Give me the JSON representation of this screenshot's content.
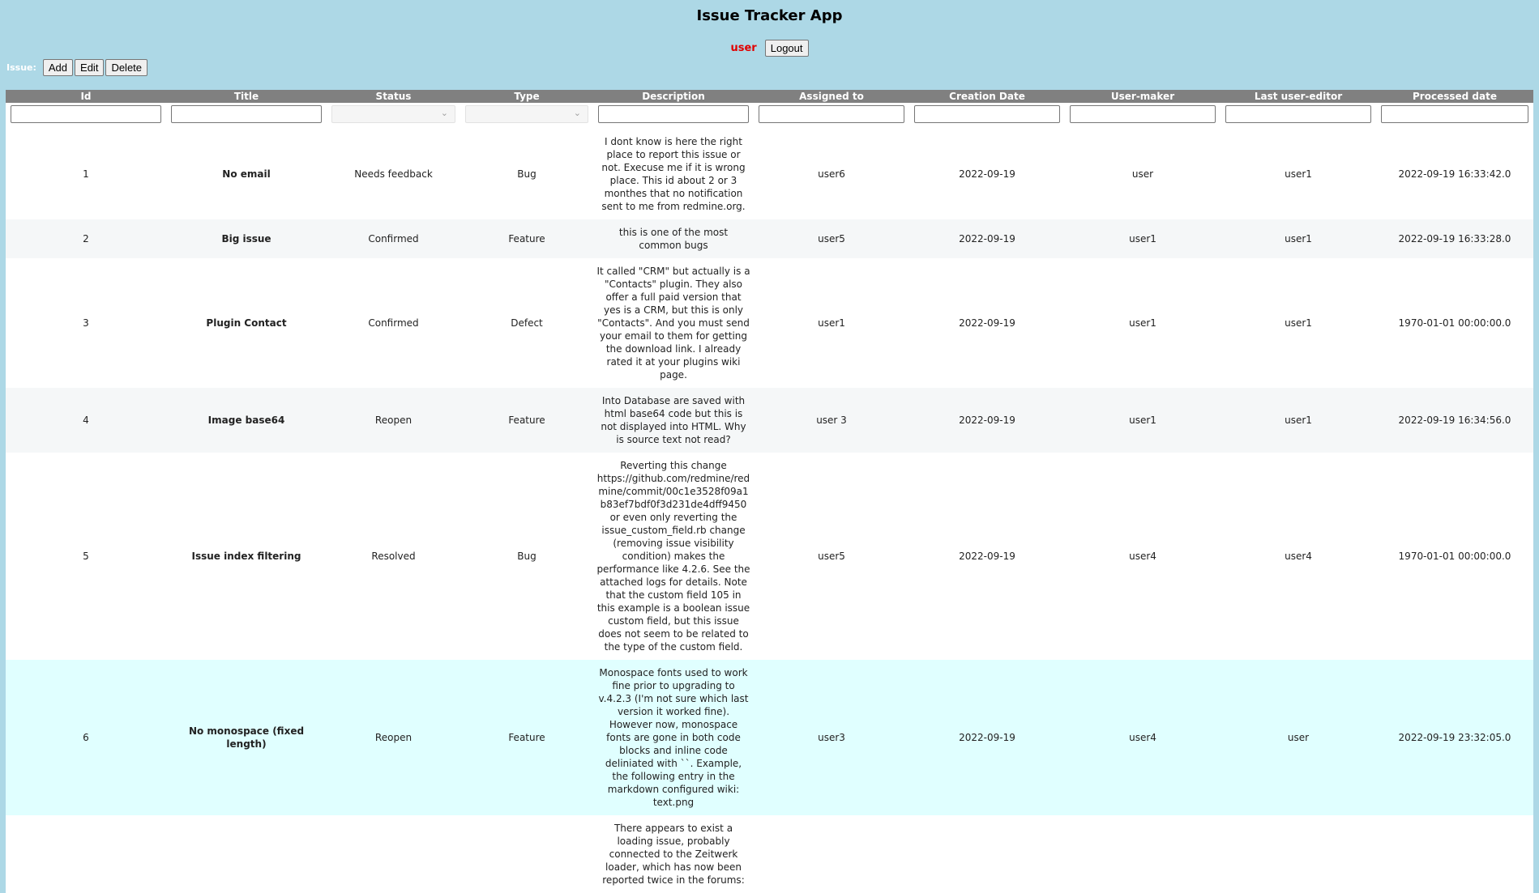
{
  "app": {
    "title": "Issue Tracker App",
    "user_name": "user",
    "logout_label": "Logout",
    "user_color": "#e00000",
    "background_color": "#add8e6"
  },
  "toolbar": {
    "label": "Issue:",
    "add_label": "Add",
    "edit_label": "Edit",
    "delete_label": "Delete"
  },
  "table": {
    "columns": [
      "Id",
      "Title",
      "Status",
      "Type",
      "Description",
      "Assigned to",
      "Creation Date",
      "User-maker",
      "Last user-editor",
      "Processed date"
    ],
    "filters": {
      "id": "",
      "title": "",
      "status": "",
      "type": "",
      "description": "",
      "assigned_to": "",
      "creation_date": "",
      "user_maker": "",
      "last_user_editor": "",
      "processed_date": ""
    },
    "rows": [
      {
        "id": "1",
        "title": "No email",
        "status": "Needs feedback",
        "type": "Bug",
        "description": "I dont know is here the right place to report this issue or not. Execuse me if it is wrong place. This id about 2 or 3 monthes that no notification sent to me from redmine.org.",
        "assigned_to": "user6",
        "creation_date": "2022-09-19",
        "user_maker": "user",
        "last_user_editor": "user1",
        "processed_date": "2022-09-19 16:33:42.0"
      },
      {
        "id": "2",
        "title": "Big issue",
        "status": "Confirmed",
        "type": "Feature",
        "description": "this is one of the most common bugs",
        "assigned_to": "user5",
        "creation_date": "2022-09-19",
        "user_maker": "user1",
        "last_user_editor": "user1",
        "processed_date": "2022-09-19 16:33:28.0"
      },
      {
        "id": "3",
        "title": "Plugin Contact",
        "status": "Confirmed",
        "type": "Defect",
        "description": "It called \"CRM\" but actually is a \"Contacts\" plugin. They also offer a full paid version that yes is a CRM, but this is only \"Contacts\". And you must send your email to them for getting the download link. I already rated it at your plugins wiki page.",
        "assigned_to": "user1",
        "creation_date": "2022-09-19",
        "user_maker": "user1",
        "last_user_editor": "user1",
        "processed_date": "1970-01-01 00:00:00.0"
      },
      {
        "id": "4",
        "title": "Image base64",
        "status": "Reopen",
        "type": "Feature",
        "description": "Into Database are saved with html base64 code but this is not displayed into HTML. Why is source text not read?",
        "assigned_to": "user 3",
        "creation_date": "2022-09-19",
        "user_maker": "user1",
        "last_user_editor": "user1",
        "processed_date": "2022-09-19 16:34:56.0"
      },
      {
        "id": "5",
        "title": "Issue index filtering",
        "status": "Resolved",
        "type": "Bug",
        "description": "Reverting this change https://github.com/redmine/redmine/commit/00c1e3528f09a1b83ef7bdf0f3d231de4dff9450 or even only reverting the issue_custom_field.rb change (removing issue visibility condition) makes the performance like 4.2.6. See the attached logs for details. Note that the custom field 105 in this example is a boolean issue custom field, but this issue does not seem to be related to the type of the custom field.",
        "assigned_to": "user5",
        "creation_date": "2022-09-19",
        "user_maker": "user4",
        "last_user_editor": "user4",
        "processed_date": "1970-01-01 00:00:00.0"
      },
      {
        "id": "6",
        "title": "No monospace (fixed length)",
        "status": "Reopen",
        "type": "Feature",
        "description": "Monospace fonts used to work fine prior to upgrading to v.4.2.3 (I'm not sure which last version it worked fine). However now, monospace fonts are gone in both code blocks and inline code deliniated with ``. Example, the following entry in the markdown configured wiki: text.png",
        "assigned_to": "user3",
        "creation_date": "2022-09-19",
        "user_maker": "user4",
        "last_user_editor": "user",
        "processed_date": "2022-09-19 23:32:05.0",
        "highlighted": true
      },
      {
        "id": "",
        "title": "",
        "status": "",
        "type": "",
        "description": "There appears to exist a loading issue, probably connected to the Zeitwerk loader, which has now been reported twice in the forums:",
        "assigned_to": "",
        "creation_date": "",
        "user_maker": "",
        "last_user_editor": "",
        "processed_date": ""
      }
    ]
  }
}
